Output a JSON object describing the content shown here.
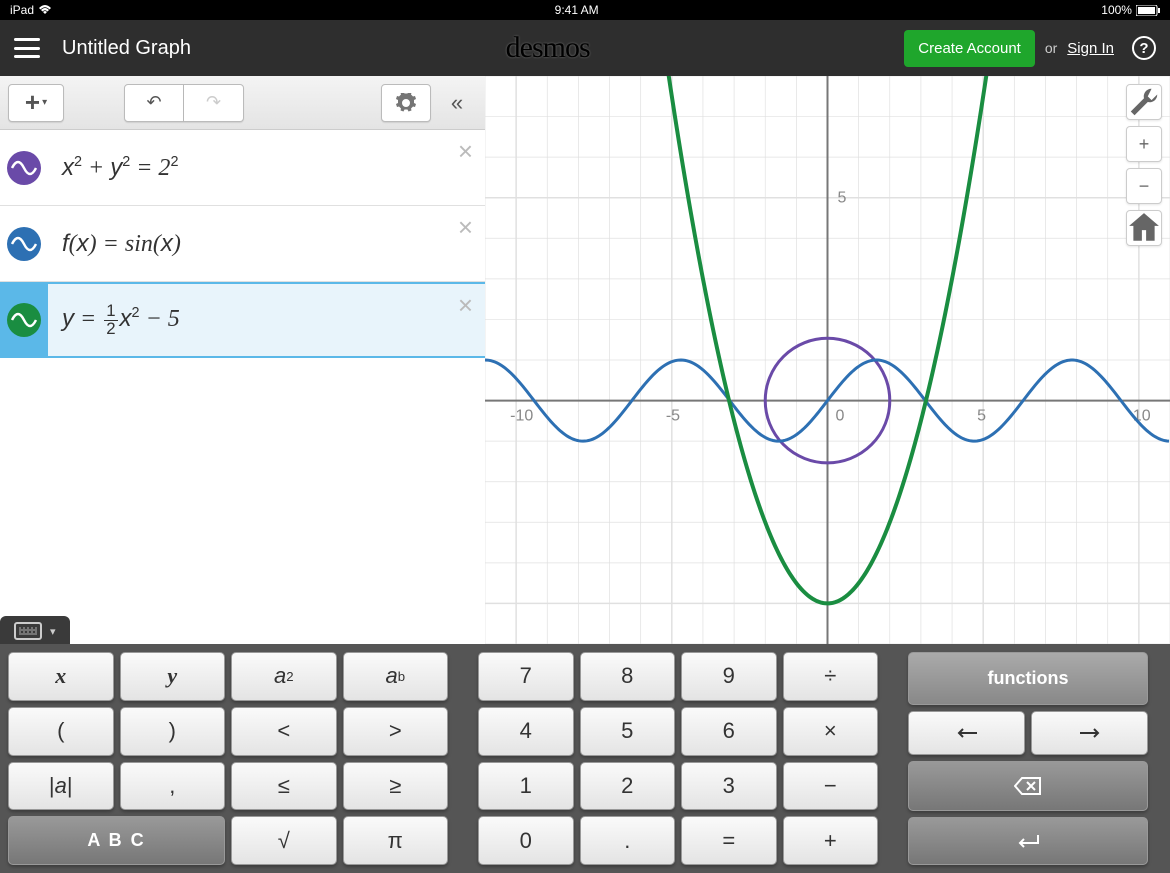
{
  "status": {
    "device": "iPad",
    "time": "9:41 AM",
    "battery": "100%"
  },
  "header": {
    "title": "Untitled Graph",
    "brand": "desmos",
    "create": "Create Account",
    "or": "or",
    "signin": "Sign In"
  },
  "expressions": [
    {
      "color": "#6a4aa8",
      "latex": "x² + y² = 2²",
      "active": false
    },
    {
      "color": "#2d70b3",
      "latex": "f(x) = sin(x)",
      "active": false
    },
    {
      "color": "#1a8d41",
      "latex": "y = ½x² − 5",
      "active": true
    }
  ],
  "chart_data": {
    "type": "line",
    "title": "",
    "xlabel": "",
    "ylabel": "",
    "xlim": [
      -11,
      11
    ],
    "ylim": [
      -6,
      8
    ],
    "xticks": [
      -10,
      -5,
      0,
      5,
      10
    ],
    "yticks": [
      5
    ],
    "grid": true,
    "series": [
      {
        "name": "circle",
        "color": "#6a4aa8",
        "equation": "x^2+y^2=4",
        "center": [
          0,
          0
        ],
        "radius": 2
      },
      {
        "name": "sine",
        "color": "#2d70b3",
        "equation": "y=sin(x)"
      },
      {
        "name": "parabola",
        "color": "#1a8d41",
        "equation": "y=0.5*x^2-5",
        "vertex": [
          0,
          -5
        ]
      }
    ]
  },
  "keyboard": {
    "g1": [
      "x",
      "y",
      "a²",
      "aᵇ",
      "(",
      ")",
      "<",
      ">",
      "|a|",
      ",",
      "≤",
      "≥",
      "A B C",
      "",
      "√",
      "π"
    ],
    "g2": [
      "7",
      "8",
      "9",
      "÷",
      "4",
      "5",
      "6",
      "×",
      "1",
      "2",
      "3",
      "−",
      "0",
      ".",
      "=",
      "+"
    ],
    "g3_func": "functions",
    "g3_left": "←",
    "g3_right": "→",
    "g3_bksp": "⌫",
    "g3_enter": "↵"
  }
}
